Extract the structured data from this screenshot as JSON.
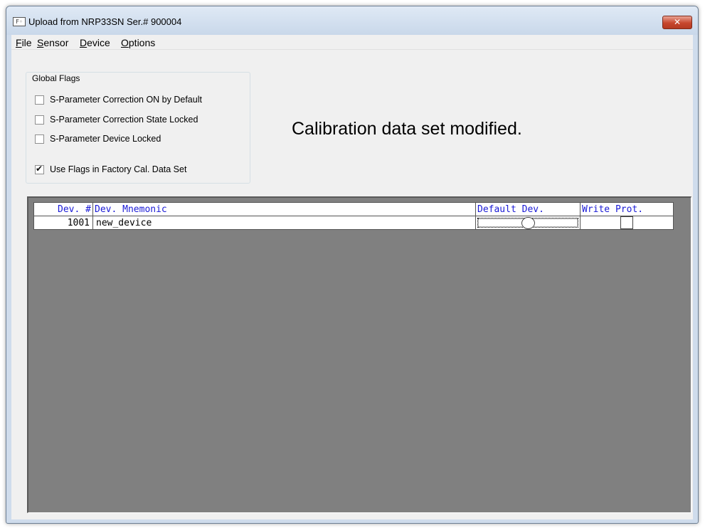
{
  "window": {
    "title": "Upload from NRP33SN Ser.# 900004",
    "app_icon_glyph": "F◦",
    "close_glyph": "✕"
  },
  "menu": [
    {
      "accel": "F",
      "rest": "ile"
    },
    {
      "accel": "S",
      "rest": "ensor"
    },
    {
      "accel": "D",
      "rest": "evice"
    },
    {
      "accel": "O",
      "rest": "ptions"
    }
  ],
  "global_flags": {
    "legend": "Global Flags",
    "flags": [
      {
        "label": "S-Parameter Correction ON by Default",
        "checked": false
      },
      {
        "label": "S-Parameter Correction State Locked",
        "checked": false
      },
      {
        "label": "S-Parameter Device Locked",
        "checked": false
      },
      {
        "label": "Use Flags in Factory Cal. Data Set",
        "checked": true
      }
    ]
  },
  "status_message": "Calibration data set modified.",
  "table": {
    "headers": [
      "Dev. #",
      "Dev. Mnemonic",
      "Default Dev.",
      "Write Prot."
    ],
    "rows": [
      {
        "dev_num": "1001",
        "mnemonic": "new_device",
        "default": false,
        "write_protected": false
      }
    ]
  },
  "colors": {
    "header_text": "#1a1ad6",
    "grid_background": "#808080",
    "client_background": "#f0f0f0",
    "close_button": "#c7472e"
  }
}
